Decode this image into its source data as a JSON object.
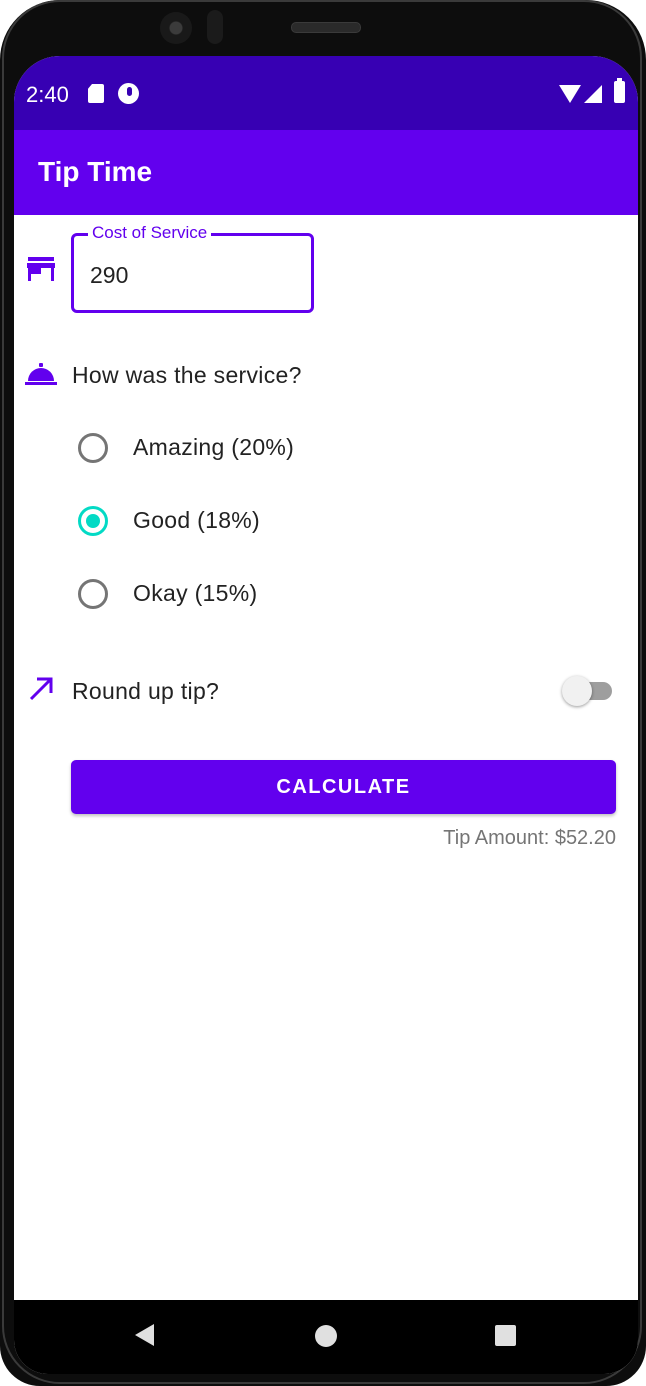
{
  "status_bar": {
    "time": "2:40",
    "icons": [
      "sd-card-icon",
      "sync-icon",
      "wifi-icon",
      "signal-icon",
      "battery-icon"
    ]
  },
  "app_bar": {
    "title": "Tip Time"
  },
  "cost_field": {
    "label": "Cost of Service",
    "value": "290",
    "icon": "storefront-icon"
  },
  "service_question": {
    "label": "How was the service?",
    "icon": "room-service-icon"
  },
  "tip_options": [
    {
      "label": "Amazing (20%)",
      "checked": false
    },
    {
      "label": "Good (18%)",
      "checked": true
    },
    {
      "label": "Okay (15%)",
      "checked": false
    }
  ],
  "round_up": {
    "label": "Round up tip?",
    "enabled": false,
    "icon": "trending-up-icon"
  },
  "calculate_button": {
    "label": "CALCULATE"
  },
  "result": {
    "text": "Tip Amount: $52.20"
  },
  "colors": {
    "primary": "#6200ee",
    "primary_dark": "#3700b3",
    "secondary": "#03dac5"
  },
  "nav_bar": {
    "icons": [
      "back-icon",
      "home-icon",
      "recents-icon"
    ]
  }
}
